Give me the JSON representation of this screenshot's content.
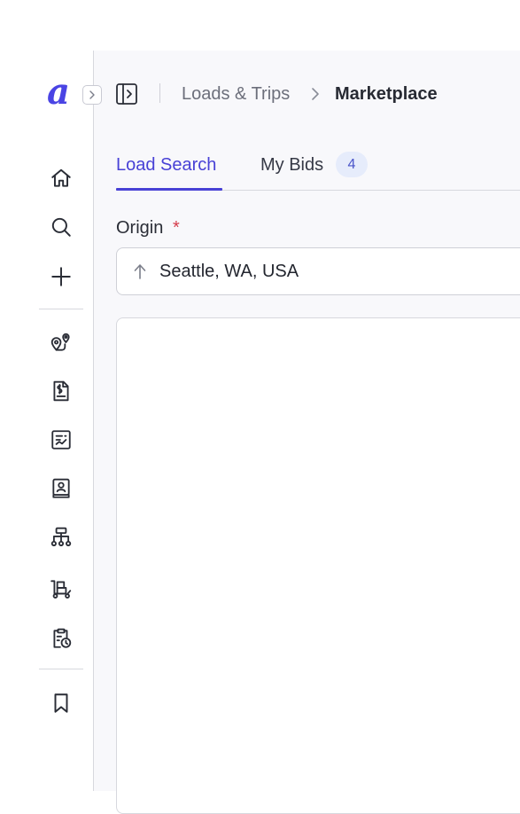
{
  "app": {
    "logo_letter": "a",
    "accent_color": "#4a44e4"
  },
  "sidebar": {
    "nav_icons": [
      "home-icon",
      "search-icon",
      "plus-icon",
      "route-pins-icon",
      "invoice-dollar-icon",
      "report-icon",
      "contact-book-icon",
      "org-hierarchy-icon",
      "truck-dolly-icon",
      "clipboard-clock-icon",
      "bookmark-icon"
    ]
  },
  "header": {
    "breadcrumb": {
      "parent": "Loads & Trips",
      "current": "Marketplace"
    }
  },
  "tabs": [
    {
      "label": "Load Search",
      "active": true
    },
    {
      "label": "My Bids",
      "badge": "4",
      "active": false
    }
  ],
  "form": {
    "origin": {
      "label": "Origin",
      "required_mark": "*",
      "value": "Seattle, WA, USA"
    }
  }
}
